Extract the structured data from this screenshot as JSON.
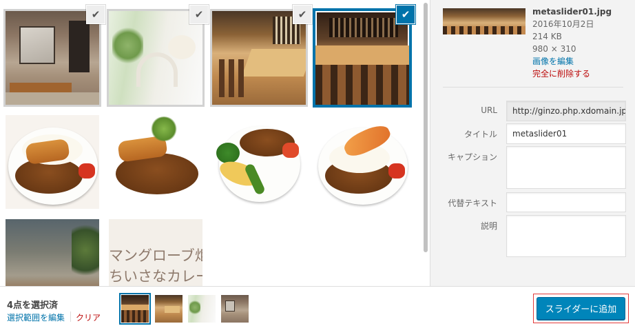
{
  "grid": {
    "items": [
      {
        "photo": "storefront",
        "selected": true,
        "focused": false
      },
      {
        "photo": "cafe-interior",
        "selected": true,
        "focused": false
      },
      {
        "photo": "bar-counter",
        "selected": true,
        "focused": false
      },
      {
        "photo": "bar-counter-wide",
        "selected": true,
        "focused": true
      },
      {
        "photo": "curry-cutlet",
        "selected": false
      },
      {
        "photo": "curry-cutlet-herb",
        "selected": false
      },
      {
        "photo": "curry-vegetables",
        "selected": false
      },
      {
        "photo": "curry-shrimp",
        "selected": false
      },
      {
        "photo": "terrace",
        "selected": false
      },
      {
        "photo": "sign",
        "selected": false,
        "sign_text": "マングローブ炬\nちいさなカレー"
      }
    ],
    "check_icon": "check-icon"
  },
  "details": {
    "filename": "metaslider01.jpg",
    "date": "2016年10月2日",
    "size": "214 KB",
    "dimensions": "980 × 310",
    "edit_image": "画像を編集",
    "delete": "完全に削除する",
    "fields": {
      "url_label": "URL",
      "url_value": "http://ginzo.php.xdomain.jp",
      "title_label": "タイトル",
      "title_value": "metaslider01",
      "caption_label": "キャプション",
      "caption_value": "",
      "alt_label": "代替テキスト",
      "alt_value": "",
      "description_label": "説明",
      "description_value": ""
    }
  },
  "footer": {
    "selected_count": "4点を選択済",
    "edit_selection": "選択範囲を編集",
    "clear": "クリア",
    "add_button": "スライダーに追加"
  },
  "colors": {
    "accent": "#0073aa",
    "button": "#0085ba",
    "danger": "#bc0b0b",
    "highlight_frame": "#e23b3b"
  }
}
